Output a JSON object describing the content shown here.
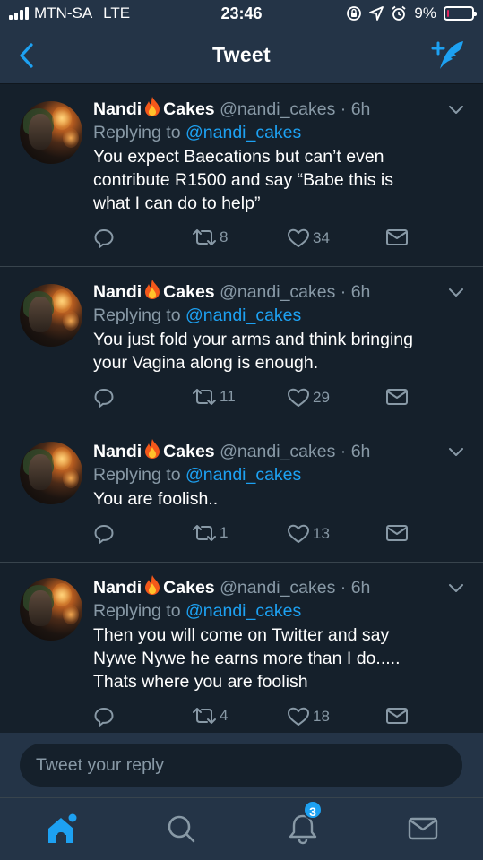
{
  "status_bar": {
    "carrier": "MTN-SA",
    "network": "LTE",
    "time": "23:46",
    "battery": "9%",
    "battery_level": 0.09,
    "icons": [
      "signal-icon",
      "lock-rotation-icon",
      "location-icon",
      "alarm-icon",
      "battery-icon"
    ]
  },
  "header": {
    "title": "Tweet",
    "back_icon": "chevron-left-icon",
    "compose_icon": "compose-tweet-icon"
  },
  "tweets": [
    {
      "name_first": "Nandi",
      "name_emoji": "fire-emoji",
      "name_last": "Cakes",
      "handle": "@nandi_cakes",
      "time": "· 6h",
      "replying_prefix": "Replying to ",
      "replying_to": "@nandi_cakes",
      "lines": [
        "You expect Baecations but can’t even",
        "contribute R1500 and say “Babe this is",
        "what I can do to help”"
      ],
      "retweets": "8",
      "likes": "34"
    },
    {
      "name_first": "Nandi",
      "name_emoji": "fire-emoji",
      "name_last": "Cakes",
      "handle": "@nandi_cakes",
      "time": "· 6h",
      "replying_prefix": "Replying to ",
      "replying_to": "@nandi_cakes",
      "lines": [
        "You just fold your arms and think bringing",
        "your Vagina along is enough."
      ],
      "retweets": "11",
      "likes": "29"
    },
    {
      "name_first": "Nandi",
      "name_emoji": "fire-emoji",
      "name_last": "Cakes",
      "handle": "@nandi_cakes",
      "time": "· 6h",
      "replying_prefix": "Replying to ",
      "replying_to": "@nandi_cakes",
      "lines": [
        "You are foolish.."
      ],
      "retweets": "1",
      "likes": "13"
    },
    {
      "name_first": "Nandi",
      "name_emoji": "fire-emoji",
      "name_last": "Cakes",
      "handle": "@nandi_cakes",
      "time": "· 6h",
      "replying_prefix": "Replying to ",
      "replying_to": "@nandi_cakes",
      "lines": [
        "Then you will come on Twitter and say",
        "Nywe Nywe he earns more than I do.....",
        "Thats where you are foolish"
      ],
      "retweets": "4",
      "likes": "18"
    }
  ],
  "reply_box": {
    "placeholder": "Tweet your reply"
  },
  "tab_bar": {
    "items": [
      "home-icon",
      "search-icon",
      "notifications-icon",
      "messages-icon"
    ],
    "notifications_badge": "3"
  },
  "colors": {
    "background": "#15202b",
    "bar_background": "#243447",
    "accent": "#1da1f2",
    "secondary_text": "#8899a6",
    "divider": "#38444d"
  }
}
